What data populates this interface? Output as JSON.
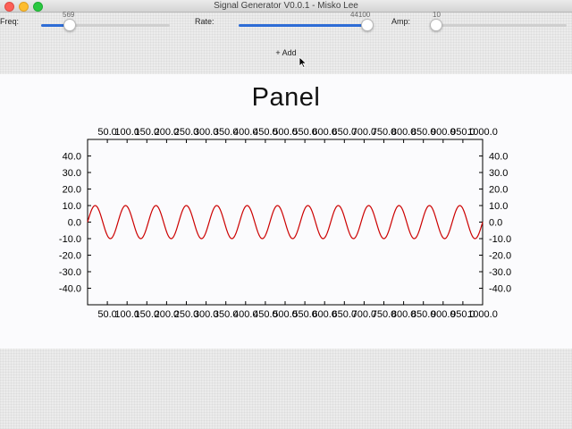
{
  "window": {
    "title": "Signal Generator V0.0.1 - Misko Lee"
  },
  "controls": {
    "freq": {
      "label": "Freq:",
      "value": "569",
      "fraction": 0.22
    },
    "rate": {
      "label": "Rate:",
      "value": "44100",
      "fraction": 1.0
    },
    "amp": {
      "label": "Amp:",
      "value": "10",
      "fraction": 0.0
    }
  },
  "toolbar": {
    "add_label": "+ Add"
  },
  "panel": {
    "title": "Panel"
  },
  "colors": {
    "accent": "#2d6cd6",
    "signal": "#cc0000"
  },
  "chart_data": {
    "type": "line",
    "title": "Panel",
    "xlim": [
      0,
      1000
    ],
    "ylim": [
      -50,
      50
    ],
    "x_tick_labels": [
      "50.0",
      "100.0",
      "150.0",
      "200.0",
      "250.0",
      "300.0",
      "350.0",
      "400.0",
      "450.0",
      "500.0",
      "550.0",
      "600.0",
      "650.0",
      "700.0",
      "750.0",
      "800.0",
      "850.0",
      "900.0",
      "950.0",
      "1000.0"
    ],
    "y_tick_labels": [
      "40.0",
      "30.0",
      "20.0",
      "10.0",
      "0.0",
      "-10.0",
      "-20.0",
      "-30.0",
      "-40.0"
    ],
    "y_ticks": [
      40,
      30,
      20,
      10,
      0,
      -10,
      -20,
      -30,
      -40
    ],
    "series": [
      {
        "function": "sine",
        "amplitude": 10,
        "cycles": 13,
        "color": "#cc0000"
      }
    ],
    "grid": false
  }
}
